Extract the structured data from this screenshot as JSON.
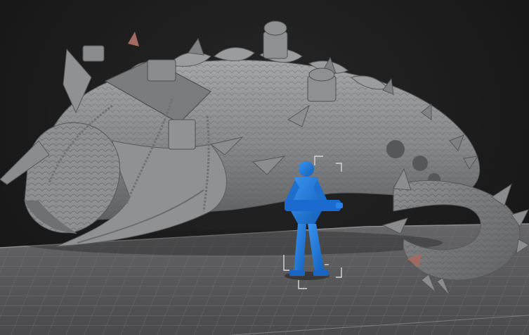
{
  "viewport": {
    "background_color": "#1e1e1e",
    "build_plate_color": "#5c5c5e",
    "plate_grid_color": "#6e6e72"
  },
  "models": [
    {
      "kind": "creature-sculpt",
      "color": "#8c8e90",
      "selected": false
    },
    {
      "kind": "figure-with-gun",
      "color": "#1f78d8",
      "selected": true
    }
  ],
  "selection_gizmo": {
    "color": "#d8d8d8",
    "handles": "corner-brackets"
  }
}
